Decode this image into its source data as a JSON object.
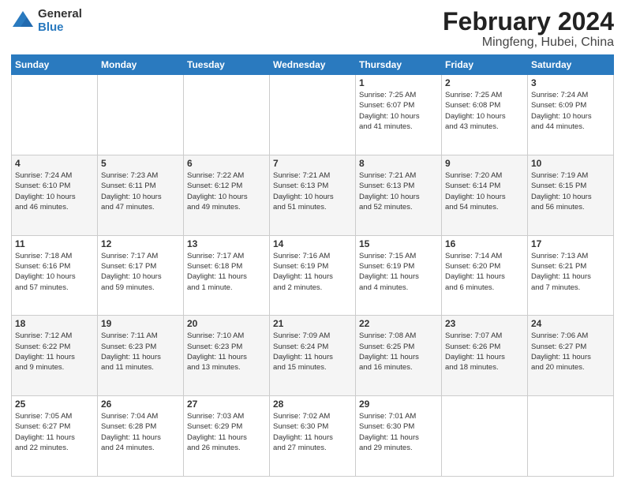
{
  "logo": {
    "general": "General",
    "blue": "Blue"
  },
  "title": "February 2024",
  "subtitle": "Mingfeng, Hubei, China",
  "weekdays": [
    "Sunday",
    "Monday",
    "Tuesday",
    "Wednesday",
    "Thursday",
    "Friday",
    "Saturday"
  ],
  "weeks": [
    [
      {
        "day": "",
        "info": ""
      },
      {
        "day": "",
        "info": ""
      },
      {
        "day": "",
        "info": ""
      },
      {
        "day": "",
        "info": ""
      },
      {
        "day": "1",
        "info": "Sunrise: 7:25 AM\nSunset: 6:07 PM\nDaylight: 10 hours\nand 41 minutes."
      },
      {
        "day": "2",
        "info": "Sunrise: 7:25 AM\nSunset: 6:08 PM\nDaylight: 10 hours\nand 43 minutes."
      },
      {
        "day": "3",
        "info": "Sunrise: 7:24 AM\nSunset: 6:09 PM\nDaylight: 10 hours\nand 44 minutes."
      }
    ],
    [
      {
        "day": "4",
        "info": "Sunrise: 7:24 AM\nSunset: 6:10 PM\nDaylight: 10 hours\nand 46 minutes."
      },
      {
        "day": "5",
        "info": "Sunrise: 7:23 AM\nSunset: 6:11 PM\nDaylight: 10 hours\nand 47 minutes."
      },
      {
        "day": "6",
        "info": "Sunrise: 7:22 AM\nSunset: 6:12 PM\nDaylight: 10 hours\nand 49 minutes."
      },
      {
        "day": "7",
        "info": "Sunrise: 7:21 AM\nSunset: 6:13 PM\nDaylight: 10 hours\nand 51 minutes."
      },
      {
        "day": "8",
        "info": "Sunrise: 7:21 AM\nSunset: 6:13 PM\nDaylight: 10 hours\nand 52 minutes."
      },
      {
        "day": "9",
        "info": "Sunrise: 7:20 AM\nSunset: 6:14 PM\nDaylight: 10 hours\nand 54 minutes."
      },
      {
        "day": "10",
        "info": "Sunrise: 7:19 AM\nSunset: 6:15 PM\nDaylight: 10 hours\nand 56 minutes."
      }
    ],
    [
      {
        "day": "11",
        "info": "Sunrise: 7:18 AM\nSunset: 6:16 PM\nDaylight: 10 hours\nand 57 minutes."
      },
      {
        "day": "12",
        "info": "Sunrise: 7:17 AM\nSunset: 6:17 PM\nDaylight: 10 hours\nand 59 minutes."
      },
      {
        "day": "13",
        "info": "Sunrise: 7:17 AM\nSunset: 6:18 PM\nDaylight: 11 hours\nand 1 minute."
      },
      {
        "day": "14",
        "info": "Sunrise: 7:16 AM\nSunset: 6:19 PM\nDaylight: 11 hours\nand 2 minutes."
      },
      {
        "day": "15",
        "info": "Sunrise: 7:15 AM\nSunset: 6:19 PM\nDaylight: 11 hours\nand 4 minutes."
      },
      {
        "day": "16",
        "info": "Sunrise: 7:14 AM\nSunset: 6:20 PM\nDaylight: 11 hours\nand 6 minutes."
      },
      {
        "day": "17",
        "info": "Sunrise: 7:13 AM\nSunset: 6:21 PM\nDaylight: 11 hours\nand 7 minutes."
      }
    ],
    [
      {
        "day": "18",
        "info": "Sunrise: 7:12 AM\nSunset: 6:22 PM\nDaylight: 11 hours\nand 9 minutes."
      },
      {
        "day": "19",
        "info": "Sunrise: 7:11 AM\nSunset: 6:23 PM\nDaylight: 11 hours\nand 11 minutes."
      },
      {
        "day": "20",
        "info": "Sunrise: 7:10 AM\nSunset: 6:23 PM\nDaylight: 11 hours\nand 13 minutes."
      },
      {
        "day": "21",
        "info": "Sunrise: 7:09 AM\nSunset: 6:24 PM\nDaylight: 11 hours\nand 15 minutes."
      },
      {
        "day": "22",
        "info": "Sunrise: 7:08 AM\nSunset: 6:25 PM\nDaylight: 11 hours\nand 16 minutes."
      },
      {
        "day": "23",
        "info": "Sunrise: 7:07 AM\nSunset: 6:26 PM\nDaylight: 11 hours\nand 18 minutes."
      },
      {
        "day": "24",
        "info": "Sunrise: 7:06 AM\nSunset: 6:27 PM\nDaylight: 11 hours\nand 20 minutes."
      }
    ],
    [
      {
        "day": "25",
        "info": "Sunrise: 7:05 AM\nSunset: 6:27 PM\nDaylight: 11 hours\nand 22 minutes."
      },
      {
        "day": "26",
        "info": "Sunrise: 7:04 AM\nSunset: 6:28 PM\nDaylight: 11 hours\nand 24 minutes."
      },
      {
        "day": "27",
        "info": "Sunrise: 7:03 AM\nSunset: 6:29 PM\nDaylight: 11 hours\nand 26 minutes."
      },
      {
        "day": "28",
        "info": "Sunrise: 7:02 AM\nSunset: 6:30 PM\nDaylight: 11 hours\nand 27 minutes."
      },
      {
        "day": "29",
        "info": "Sunrise: 7:01 AM\nSunset: 6:30 PM\nDaylight: 11 hours\nand 29 minutes."
      },
      {
        "day": "",
        "info": ""
      },
      {
        "day": "",
        "info": ""
      }
    ]
  ]
}
